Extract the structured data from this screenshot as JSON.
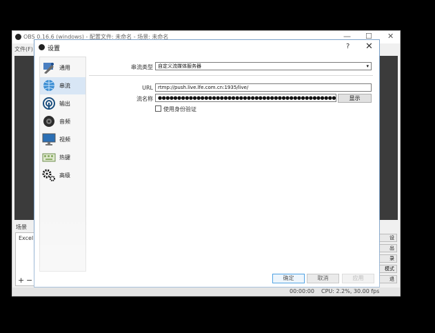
{
  "obs": {
    "title": "OBS 0.16.6 (windows) - 配置文件: 未命名 - 场景: 未命名",
    "menu": "文件(F)",
    "minimize_glyph": "—",
    "maximize_glyph": "☐",
    "close_glyph": "✕",
    "scenes_label": "场景",
    "scene_item": "Excel",
    "add_glyph": "+",
    "remove_glyph": "−",
    "side_buttons": [
      "设",
      "出",
      "录",
      "模式",
      "退"
    ],
    "status_time": "00:00:00",
    "status_cpu": "CPU: 2.2%, 30.00 fps"
  },
  "dialog": {
    "title": "设置",
    "help_glyph": "?",
    "close_glyph": "✕",
    "sidebar": [
      {
        "label": "通用",
        "icon": "general-icon"
      },
      {
        "label": "串流",
        "icon": "globe-icon"
      },
      {
        "label": "输出",
        "icon": "output-icon"
      },
      {
        "label": "音频",
        "icon": "speaker-icon"
      },
      {
        "label": "视频",
        "icon": "monitor-icon"
      },
      {
        "label": "热键",
        "icon": "keyboard-icon"
      },
      {
        "label": "高级",
        "icon": "gears-icon"
      }
    ],
    "service_label": "串流类型",
    "service_value": "自定义流媒体服务器",
    "url_label": "URL",
    "url_value": "rtmp://push.live.lfe.com.cn:1935/live/",
    "key_label": "流名称",
    "key_value": "●●●●●●●●●●●●●●●●●●●●●●●●●●●●●●●●●●●●●●●●●●●●●●●●●●●●",
    "show_label": "显示",
    "auth_label": "使用身份验证",
    "ok_label": "确定",
    "cancel_label": "取消",
    "apply_label": "应用"
  },
  "colors": {
    "accent": "#0078d7",
    "active_item": "#d8e6f5"
  }
}
